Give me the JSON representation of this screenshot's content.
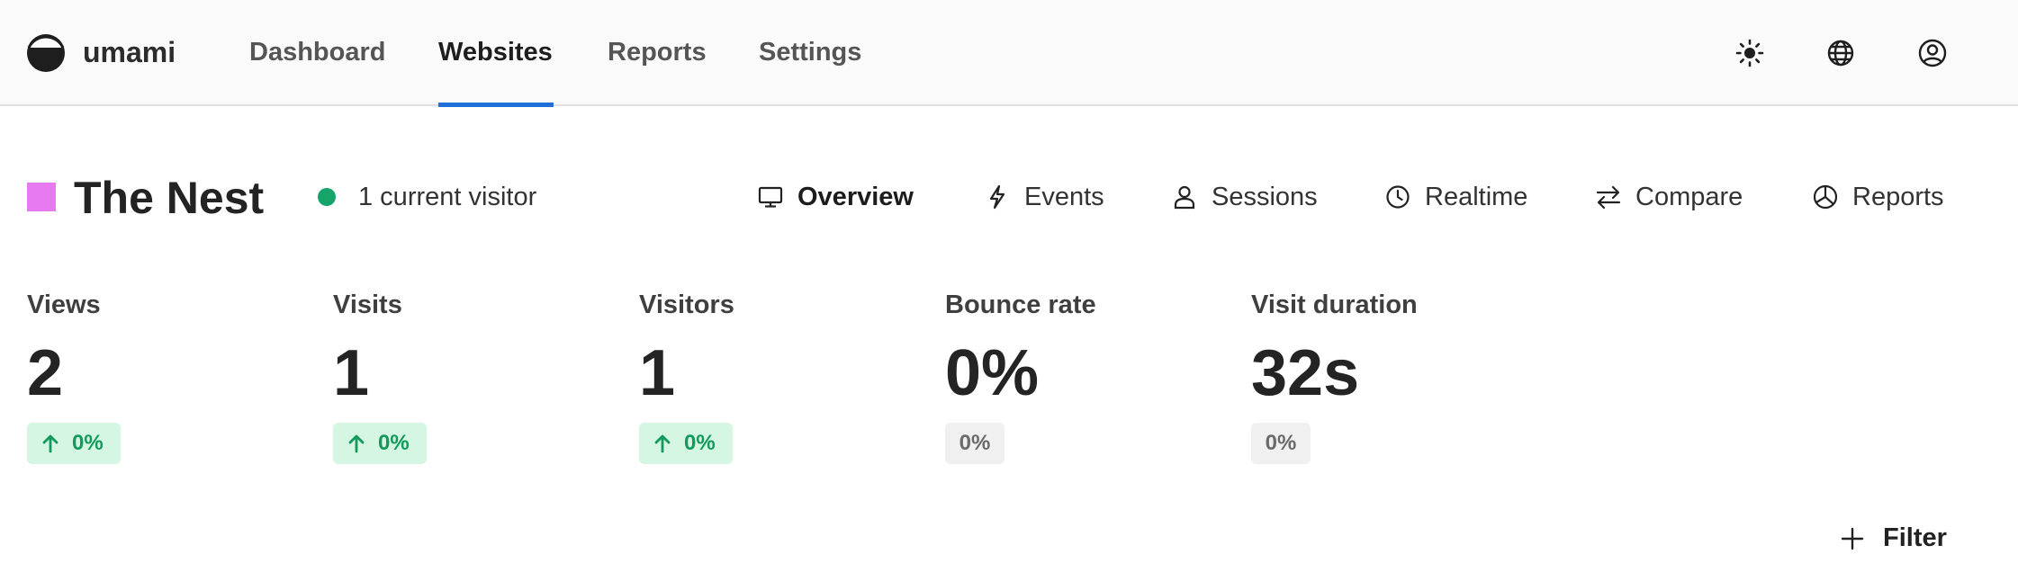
{
  "app": {
    "brand": "umami",
    "logo_icon": "umami-logo-icon"
  },
  "nav": {
    "items": [
      {
        "label": "Dashboard",
        "active": false
      },
      {
        "label": "Websites",
        "active": true
      },
      {
        "label": "Reports",
        "active": false
      },
      {
        "label": "Settings",
        "active": false
      }
    ]
  },
  "header_icons": [
    {
      "name": "theme-toggle-sun-icon"
    },
    {
      "name": "language-globe-icon"
    },
    {
      "name": "profile-user-icon"
    }
  ],
  "website": {
    "name": "The Nest",
    "color": "#e779f1",
    "visitors_live": "1 current visitor",
    "live_color": "#15a56b"
  },
  "tabs": [
    {
      "label": "Overview",
      "icon": "monitor-icon",
      "active": true
    },
    {
      "label": "Events",
      "icon": "lightning-icon",
      "active": false
    },
    {
      "label": "Sessions",
      "icon": "user-icon",
      "active": false
    },
    {
      "label": "Realtime",
      "icon": "clock-icon",
      "active": false
    },
    {
      "label": "Compare",
      "icon": "compare-arrows-icon",
      "active": false
    },
    {
      "label": "Reports",
      "icon": "pie-chart-icon",
      "active": false
    }
  ],
  "metrics": [
    {
      "label": "Views",
      "value": "2",
      "change": "0%",
      "trend": "up"
    },
    {
      "label": "Visits",
      "value": "1",
      "change": "0%",
      "trend": "up"
    },
    {
      "label": "Visitors",
      "value": "1",
      "change": "0%",
      "trend": "up"
    },
    {
      "label": "Bounce rate",
      "value": "0%",
      "change": "0%",
      "trend": "neutral"
    },
    {
      "label": "Visit duration",
      "value": "32s",
      "change": "0%",
      "trend": "neutral"
    }
  ],
  "filter": {
    "label": "Filter",
    "icon": "plus-icon"
  },
  "colors": {
    "accent": "#1f6fd8",
    "positive_bg": "#d4f6e3",
    "positive_text": "#119a5b",
    "neutral_bg": "#f0f0f0"
  }
}
